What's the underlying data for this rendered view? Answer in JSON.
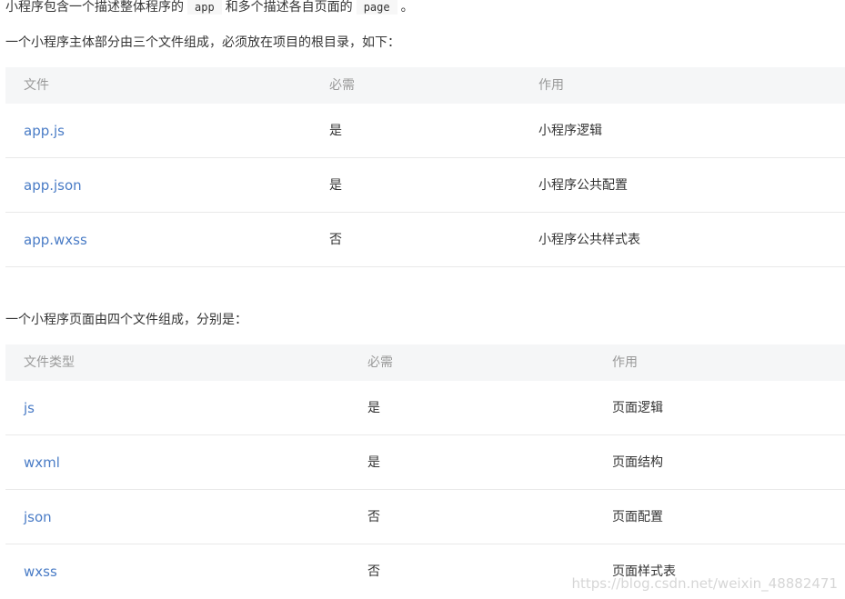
{
  "intro": {
    "part1": "小程序包含一个描述整体程序的",
    "code1": "app",
    "part2": "和多个描述各自页面的",
    "code2": "page",
    "part3": "。"
  },
  "section1": {
    "text": "一个小程序主体部分由三个文件组成，必须放在项目的根目录，如下：",
    "headers": [
      "文件",
      "必需",
      "作用"
    ],
    "rows": [
      {
        "file": "app.js",
        "required": "是",
        "purpose": "小程序逻辑"
      },
      {
        "file": "app.json",
        "required": "是",
        "purpose": "小程序公共配置"
      },
      {
        "file": "app.wxss",
        "required": "否",
        "purpose": "小程序公共样式表"
      }
    ]
  },
  "section2": {
    "text": "一个小程序页面由四个文件组成，分别是：",
    "headers": [
      "文件类型",
      "必需",
      "作用"
    ],
    "rows": [
      {
        "file": "js",
        "required": "是",
        "purpose": "页面逻辑"
      },
      {
        "file": "wxml",
        "required": "是",
        "purpose": "页面结构"
      },
      {
        "file": "json",
        "required": "否",
        "purpose": "页面配置"
      },
      {
        "file": "wxss",
        "required": "否",
        "purpose": "页面样式表"
      }
    ]
  },
  "watermark": "https://blog.csdn.net/weixin_48882471"
}
